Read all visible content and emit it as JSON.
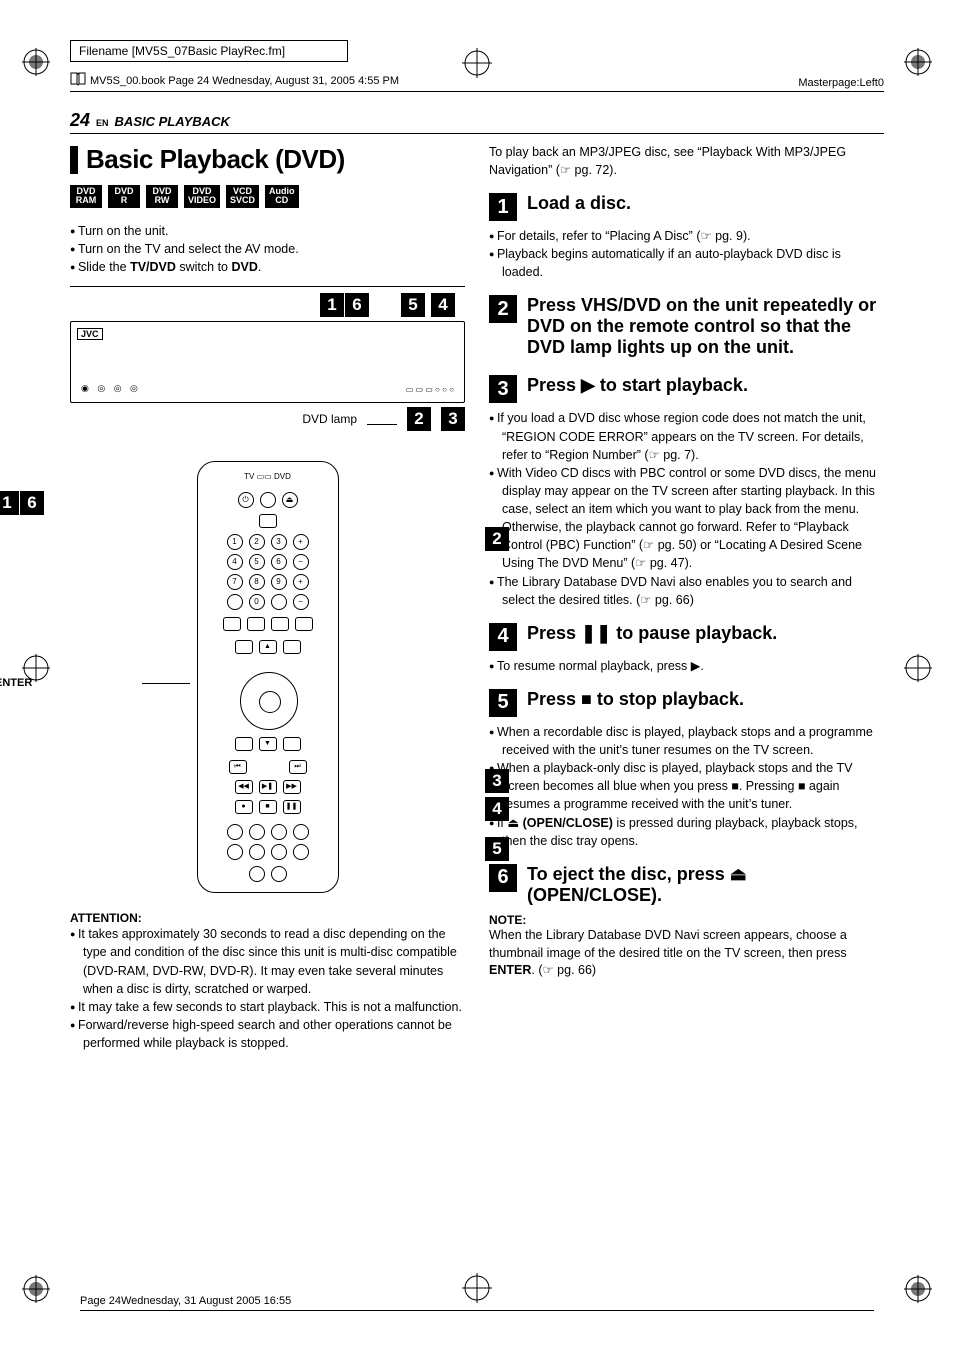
{
  "meta": {
    "filename_label": "Filename [MV5S_07Basic PlayRec.fm]",
    "book_line": "MV5S_00.book  Page 24  Wednesday, August 31, 2005  4:55 PM",
    "masterpage": "Masterpage:Left0",
    "footer": "Page 24Wednesday, 31 August 2005  16:55"
  },
  "page_header": {
    "number": "24",
    "lang": "EN",
    "section": "BASIC PLAYBACK"
  },
  "left": {
    "title": "Basic Playback (DVD)",
    "badges": [
      {
        "l1": "DVD",
        "l2": "RAM"
      },
      {
        "l1": "DVD",
        "l2": "R"
      },
      {
        "l1": "DVD",
        "l2": "RW"
      },
      {
        "l1": "DVD",
        "l2": "VIDEO"
      },
      {
        "l1": "VCD",
        "l2": "SVCD"
      },
      {
        "l1": "Audio",
        "l2": "CD"
      }
    ],
    "intro": [
      "Turn on the unit.",
      "Turn on the TV and select the AV mode.",
      "Slide the <b>TV/DVD</b> switch to <b>DVD</b>."
    ],
    "device_callouts_top": [
      "1",
      "6",
      "5",
      "4"
    ],
    "dvd_lamp_label": "DVD lamp",
    "device_callouts_bot": [
      "2",
      "3"
    ],
    "remote_left_labels": {
      "enter": "ENTER"
    },
    "remote_left_callouts": [
      "1",
      "6"
    ],
    "remote_right_callouts": [
      "2",
      "3",
      "4",
      "5"
    ],
    "remote_top_labels": {
      "tv": "TV",
      "dvd": "DVD"
    },
    "jvc": "JVC",
    "attention_h": "ATTENTION:",
    "attention": [
      "It takes approximately 30 seconds to read a disc depending on the type and condition of the disc since this unit is multi-disc compatible (DVD-RAM, DVD-RW, DVD-R). It may even take several minutes when a disc is dirty, scratched or warped.",
      "It may take a few seconds to start playback. This is not a malfunction.",
      "Forward/reverse high-speed search and other operations cannot be performed while playback is stopped."
    ]
  },
  "right": {
    "intro": "To play back an MP3/JPEG disc, see “Playback With MP3/JPEG Navigation” (☞ pg. 72).",
    "steps": [
      {
        "num": "1",
        "title": "Load a disc.",
        "body": [
          "For details, refer to “Placing A Disc” (☞ pg. 9).",
          "Playback begins automatically if an auto-playback DVD disc is loaded."
        ]
      },
      {
        "num": "2",
        "title": "Press VHS/DVD on the unit repeatedly or DVD on the remote control so that the DVD lamp lights up on the unit.",
        "body": []
      },
      {
        "num": "3",
        "title": "Press ▶ to start playback.",
        "body": [
          "If you load a DVD disc whose region code does not match the unit, “REGION CODE ERROR” appears on the TV screen. For details, refer to “Region Number” (☞ pg. 7).",
          "With Video CD discs with PBC control or some DVD discs, the menu display may appear on the TV screen after starting playback. In this case, select an item which you want to play back from the menu. Otherwise, the playback cannot go forward. Refer to “Playback Control (PBC) Function” (☞ pg. 50) or “Locating A Desired Scene Using The DVD Menu” (☞ pg. 47).",
          "The Library Database DVD Navi also enables you to search and select the desired titles. (☞ pg. 66)"
        ]
      },
      {
        "num": "4",
        "title": "Press ❚❚ to pause playback.",
        "body": [
          "To resume normal playback, press ▶."
        ]
      },
      {
        "num": "5",
        "title": "Press ■ to stop playback.",
        "body": [
          "When a recordable disc is played, playback stops and a programme received with the unit’s tuner resumes on the TV screen.",
          "When a playback-only disc is played, playback stops and the TV screen becomes all blue when you press ■. Pressing ■ again resumes a programme received with the unit’s tuner.",
          "If ⏏ <b>(OPEN/CLOSE)</b> is pressed during playback, playback stops, then the disc tray opens."
        ]
      },
      {
        "num": "6",
        "title": "To eject the disc, press ⏏ (OPEN/CLOSE).",
        "body": []
      }
    ],
    "note_h": "NOTE:",
    "note": "When the Library Database DVD Navi screen appears, choose a thumbnail image of the desired title on the TV screen, then press <b>ENTER</b>. (☞ pg. 66)"
  }
}
